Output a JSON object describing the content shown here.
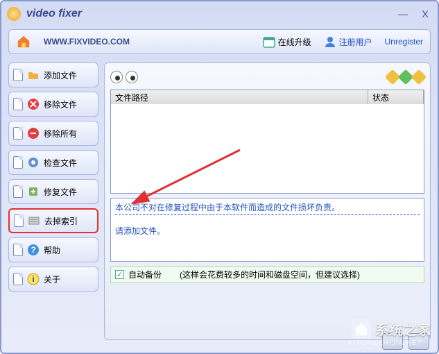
{
  "app": {
    "title": "video fixer",
    "url": "WWW.FIXVIDEO.COM"
  },
  "window_controls": {
    "min": "—",
    "close": "X"
  },
  "header": {
    "upgrade": "在线升级",
    "register": "注册用户",
    "unregister": "Unregister"
  },
  "sidebar": {
    "items": [
      {
        "label": "添加文件",
        "icon": "folder-add-icon"
      },
      {
        "label": "移除文件",
        "icon": "remove-icon"
      },
      {
        "label": "移除所有",
        "icon": "remove-all-icon"
      },
      {
        "label": "检查文件",
        "icon": "check-icon"
      },
      {
        "label": "修复文件",
        "icon": "repair-icon"
      },
      {
        "label": "去掉索引",
        "icon": "index-icon"
      },
      {
        "label": "帮助",
        "icon": "help-icon"
      },
      {
        "label": "关于",
        "icon": "about-icon"
      }
    ]
  },
  "table": {
    "col_path": "文件路径",
    "col_status": "状态"
  },
  "messages": {
    "disclaimer": "本公司不对在修复过程中由于本软件而造成的文件损坏负责。",
    "prompt": "请添加文件。"
  },
  "backup": {
    "label": "自动备份",
    "hint": "(这样会花费较多的时间和磁盘空间，但建议选择)"
  },
  "watermark": {
    "name": "系统之家",
    "sub": "XITONGZHIJIA.NET"
  },
  "colors": {
    "hex1": "#f0c040",
    "hex2": "#60c060",
    "hex3": "#f0c040"
  }
}
